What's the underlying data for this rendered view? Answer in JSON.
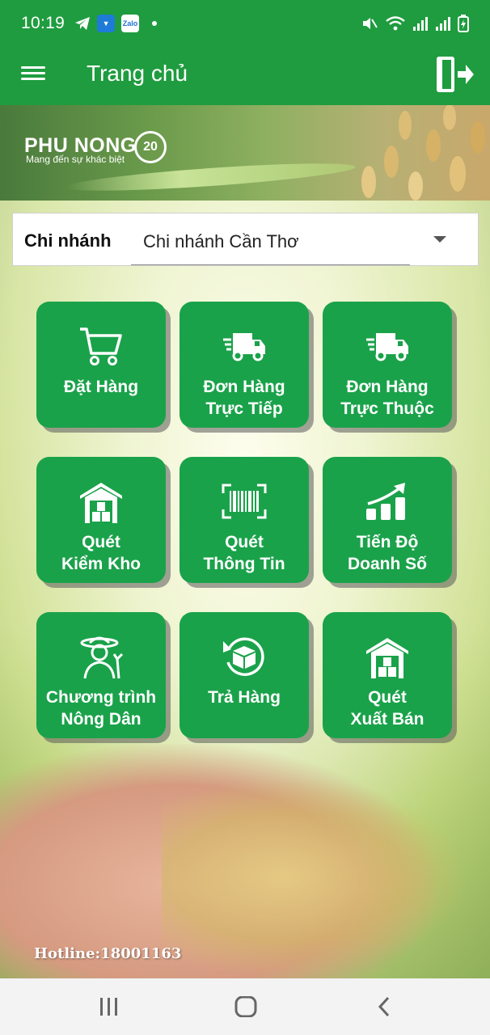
{
  "status_bar": {
    "time": "10:19",
    "apps": [
      {
        "icon": "telegram-icon"
      },
      {
        "icon": "app-icon"
      },
      {
        "icon": "zalo-icon",
        "label": "Zalo"
      }
    ],
    "right_icons": [
      "mute-icon",
      "wifi-icon",
      "signal-icon",
      "signal-icon",
      "battery-icon"
    ]
  },
  "app_bar": {
    "title": "Trang chủ",
    "menu_icon": "hamburger-menu-icon",
    "logout_icon": "logout-icon"
  },
  "banner": {
    "brand_name": "PHU NONG",
    "slogan": "Mang đến sự khác biệt",
    "mark": "20"
  },
  "branch": {
    "label": "Chi nhánh",
    "selected": "Chi nhánh Cần Thơ"
  },
  "tiles": [
    {
      "line1": "Đặt Hàng",
      "line2": "",
      "icon": "shopping-cart-icon"
    },
    {
      "line1": "Đơn Hàng",
      "line2": "Trực Tiếp",
      "icon": "delivery-truck-icon"
    },
    {
      "line1": "Đơn Hàng",
      "line2": "Trực Thuộc",
      "icon": "delivery-truck-icon"
    },
    {
      "line1": "Quét",
      "line2": "Kiểm Kho",
      "icon": "warehouse-icon"
    },
    {
      "line1": "Quét",
      "line2": "Thông Tin",
      "icon": "barcode-scan-icon"
    },
    {
      "line1": "Tiến Độ",
      "line2": "Doanh Số",
      "icon": "sales-growth-icon"
    },
    {
      "line1": "Chương trình",
      "line2": "Nông Dân",
      "icon": "farmer-icon"
    },
    {
      "line1": "Trả Hàng",
      "line2": "",
      "icon": "return-box-icon"
    },
    {
      "line1": "Quét",
      "line2": "Xuất Bán",
      "icon": "warehouse-icon"
    }
  ],
  "hotline": "Hotline:18001163",
  "nav_bar": {
    "items": [
      "recent-apps-icon",
      "home-icon",
      "back-icon"
    ]
  },
  "colors": {
    "primary": "#1f9c3f",
    "tile": "#1aa24a",
    "nav_bg": "#f3f3f3"
  }
}
